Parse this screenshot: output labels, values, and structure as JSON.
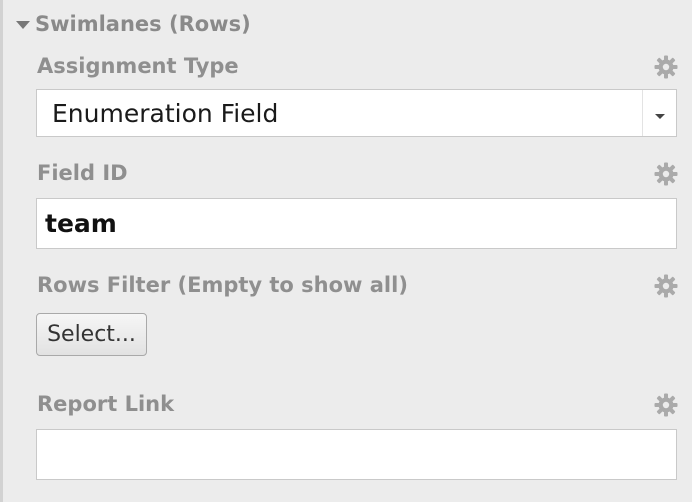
{
  "section": {
    "title": "Swimlanes (Rows)"
  },
  "fields": {
    "assignment_type": {
      "label": "Assignment Type",
      "value": "Enumeration Field"
    },
    "field_id": {
      "label": "Field ID",
      "value": "team"
    },
    "rows_filter": {
      "label": "Rows Filter (Empty to show all)",
      "button_label": "Select..."
    },
    "report_link": {
      "label": "Report Link",
      "value": ""
    }
  },
  "colors": {
    "panel_background": "#ececec",
    "label_text": "#8f8f8f",
    "gear_icon": "#aaaaaa"
  },
  "icons": {
    "section_toggle": "caret-down-icon",
    "settings": "gear-icon"
  }
}
